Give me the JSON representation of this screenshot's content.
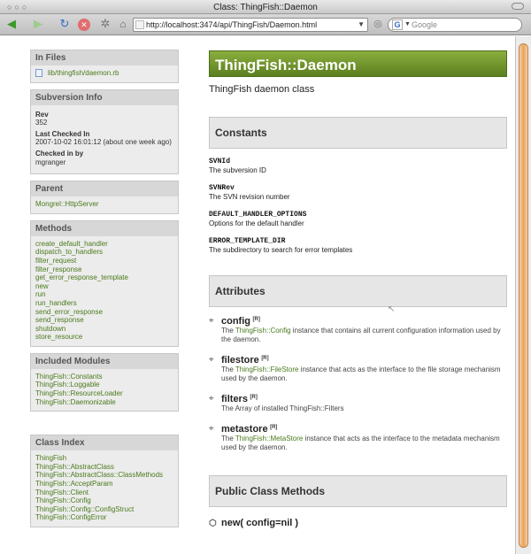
{
  "window": {
    "title": "Class: ThingFish::Daemon",
    "lights": "○○○"
  },
  "toolbar": {
    "back_icon": "◀",
    "forward_icon": "▶",
    "reload_icon": "↻",
    "stop_icon": "✕",
    "gear_icon": "✲",
    "home_icon": "⌂",
    "url": "http://localhost:3474/api/ThingFish/Daemon.html",
    "addr_caret": "▼",
    "go_icon": "◎",
    "search_placeholder": "Google",
    "search_engine_glyph": "G",
    "search_dropdown": "▼"
  },
  "sidebar": {
    "in_files": {
      "title": "In Files",
      "files": [
        "lib/thingfish/daemon.rb"
      ]
    },
    "svn": {
      "title": "Subversion Info",
      "rev_label": "Rev",
      "rev_value": "352",
      "checked_label": "Last Checked In",
      "checked_value": "2007-10-02 16:01:12 (about one week ago)",
      "by_label": "Checked in by",
      "by_value": "mgranger"
    },
    "parent": {
      "title": "Parent",
      "link": "Mongrel::HttpServer"
    },
    "methods": {
      "title": "Methods",
      "items": [
        "create_default_handler",
        "dispatch_to_handlers",
        "filter_request",
        "filter_response",
        "get_error_response_template",
        "new",
        "run",
        "run_handlers",
        "send_error_response",
        "send_response",
        "shutdown",
        "store_resource"
      ]
    },
    "modules": {
      "title": "Included Modules",
      "items": [
        "ThingFish::Constants",
        "ThingFish::Loggable",
        "ThingFish::ResourceLoader",
        "ThingFish::Daemonizable"
      ]
    },
    "class_index": {
      "title": "Class Index",
      "items": [
        "ThingFish",
        "ThingFish::AbstractClass",
        "ThingFish::AbstractClass::ClassMethods",
        "ThingFish::AcceptParam",
        "ThingFish::Client",
        "ThingFish::Config",
        "ThingFish::Config::ConfigStruct",
        "ThingFish::ConfigError"
      ]
    }
  },
  "main": {
    "class_title": "ThingFish::Daemon",
    "subtitle": "ThingFish daemon class",
    "constants_heading": "Constants",
    "constants": [
      {
        "name": "SVNId",
        "desc": "The subversion ID"
      },
      {
        "name": "SVNRev",
        "desc": "The SVN revision number"
      },
      {
        "name": "DEFAULT_HANDLER_OPTIONS",
        "desc": "Options for the default handler"
      },
      {
        "name": "ERROR_TEMPLATE_DIR",
        "desc": "The subdirectory to search for error templates"
      }
    ],
    "attributes_heading": "Attributes",
    "attributes": [
      {
        "name": "config",
        "mode": "[R]",
        "pre": "The ",
        "link": "ThingFish::Config",
        "post": " instance that contains all current configuration information used by the daemon."
      },
      {
        "name": "filestore",
        "mode": "[R]",
        "pre": "The ",
        "link": "ThingFish::FileStore",
        "post": " instance that acts as the interface to the file storage mechanism used by the daemon."
      },
      {
        "name": "filters",
        "mode": "[R]",
        "pre": "The Array of installed ThingFish::Filters",
        "link": "",
        "post": ""
      },
      {
        "name": "metastore",
        "mode": "[R]",
        "pre": "The ",
        "link": "ThingFish::MetaStore",
        "post": " instance that acts as the interface to the metadata mechanism used by the daemon."
      }
    ],
    "public_methods_heading": "Public Class Methods",
    "first_method": "new( config=nil )"
  },
  "icons": {
    "attribute_icon": "⌖",
    "method_icon": "⬡",
    "cursor": "↖"
  }
}
